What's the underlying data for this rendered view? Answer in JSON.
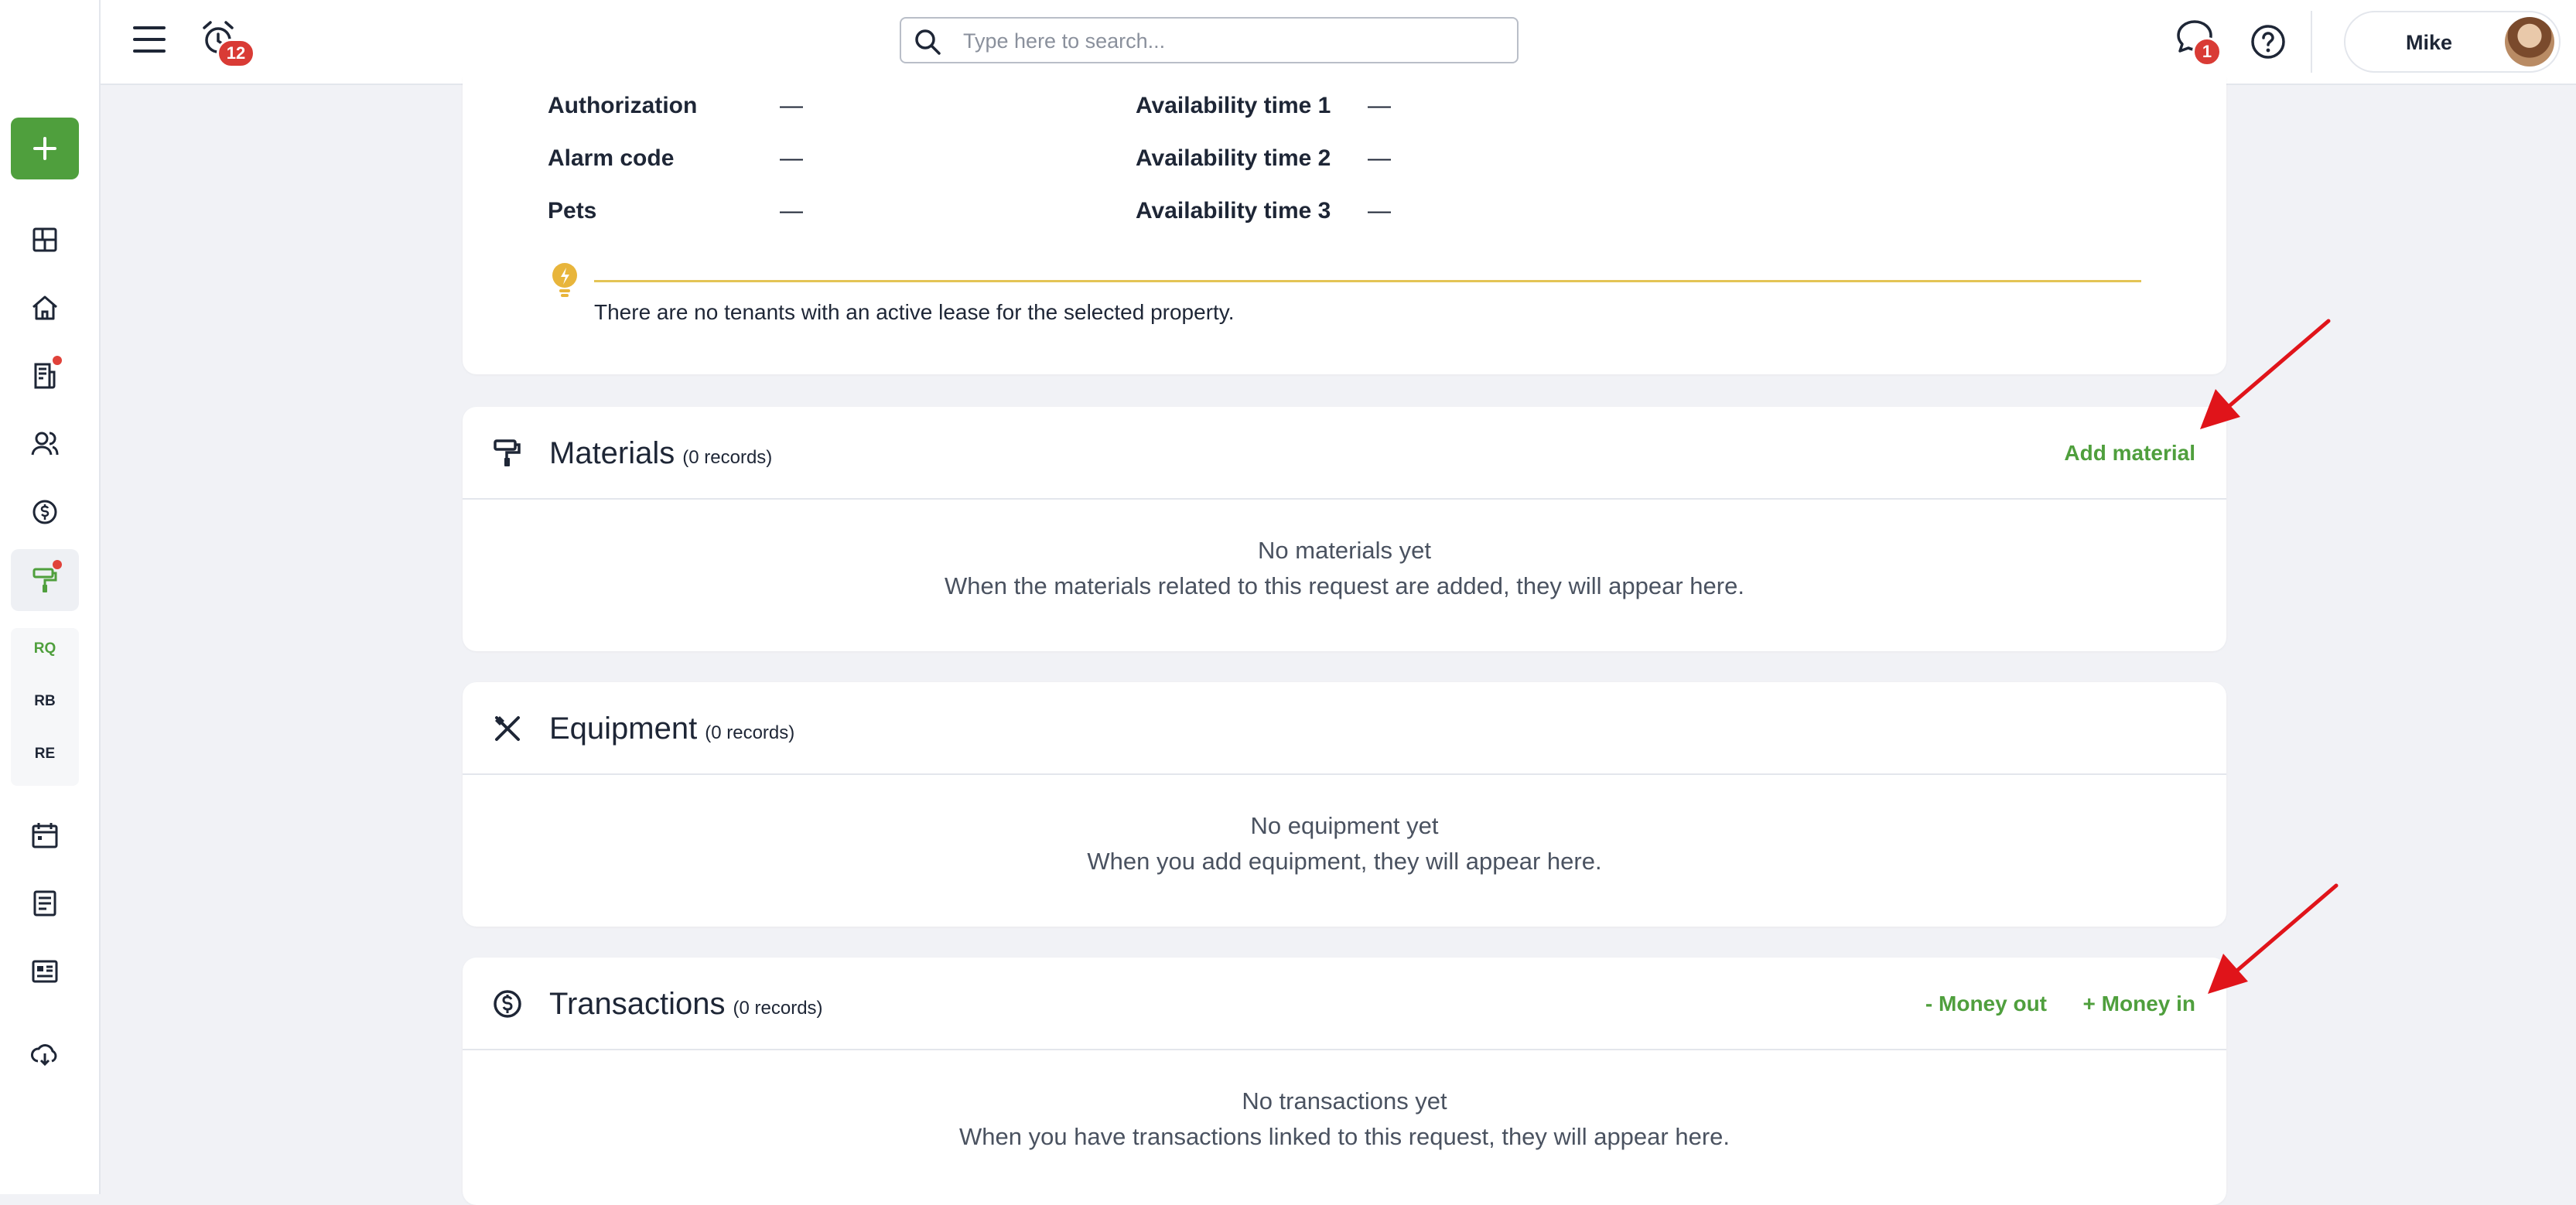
{
  "header": {
    "alarm_badge": "12",
    "search_placeholder": "Type here to search...",
    "chat_badge": "1",
    "user_name": "Mike"
  },
  "sidebar": {
    "add_label": "+",
    "sub_items": [
      "RQ",
      "RB",
      "RE"
    ]
  },
  "details": {
    "left": [
      {
        "label": "Authorization",
        "value": "—"
      },
      {
        "label": "Alarm code",
        "value": "—"
      },
      {
        "label": "Pets",
        "value": "—"
      }
    ],
    "right": [
      {
        "label": "Availability time 1",
        "value": "—"
      },
      {
        "label": "Availability time 2",
        "value": "—"
      },
      {
        "label": "Availability time 3",
        "value": "—"
      }
    ],
    "tip": "There are no tenants with an active lease for the selected property."
  },
  "materials": {
    "title": "Materials",
    "count": "(0 records)",
    "action": "Add material",
    "empty_title": "No materials yet",
    "empty_sub": "When the materials related to this request are added, they will appear here."
  },
  "equipment": {
    "title": "Equipment",
    "count": "(0 records)",
    "empty_title": "No equipment yet",
    "empty_sub": "When you add equipment, they will appear here."
  },
  "transactions": {
    "title": "Transactions",
    "count": "(0 records)",
    "action_out": "- Money out",
    "action_in": "+ Money in",
    "empty_title": "No transactions yet",
    "empty_sub": "When you have transactions linked to this request, they will appear here."
  },
  "colors": {
    "accent": "#4f9f3d",
    "badge": "#d93b35",
    "annotation_arrow": "#e0141a"
  }
}
